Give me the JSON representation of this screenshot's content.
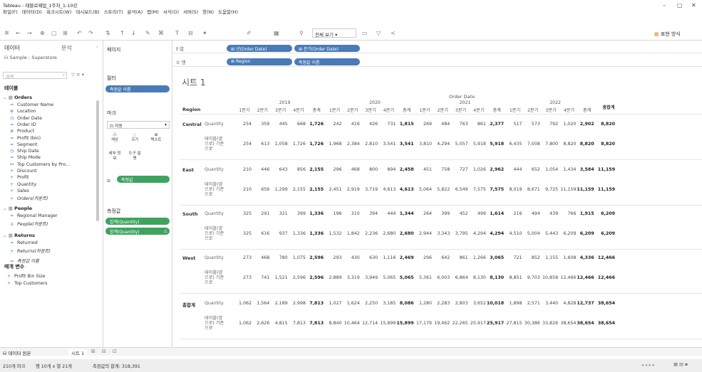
{
  "app": {
    "title": "Tableau - 태블로웨업_1주차_1-10강",
    "menu": [
      "파일(F)",
      "데이터(D)",
      "워크시트(W)",
      "대시보드(B)",
      "스토리(T)",
      "분석(A)",
      "맵(M)",
      "서식(O)",
      "서버(S)",
      "창(N)",
      "도움말(H)"
    ],
    "view_select": "전체 보기",
    "show_me": "표현 방식"
  },
  "left": {
    "tab_data": "데이터",
    "tab_analysis": "분석",
    "source": "Sample - Superstore",
    "search_placeholder": "검색",
    "tables_header": "테이블",
    "orders": "Orders",
    "fields": [
      "Customer Name",
      "Location",
      "Order Date",
      "Order ID",
      "Product",
      "Profit (bin)",
      "Segment",
      "Ship Date",
      "Ship Mode",
      "Top Customers by Pro...",
      "Discount",
      "Profit",
      "Quantity",
      "Sales",
      "Orders(카운트)"
    ],
    "people": "People",
    "people_fields": [
      "Regional Manager",
      "People(카운트)"
    ],
    "returns": "Returns",
    "returns_fields": [
      "Returned",
      "Returns(카운트)"
    ],
    "measure_names": "측정값 이름",
    "params_header": "매개 변수",
    "params": [
      "Profit Bin Size",
      "Top Customers"
    ]
  },
  "cards": {
    "pages": "페이지",
    "filters": "필터",
    "filter_pill": "측정값 이름",
    "marks": "마크",
    "mark_type": "자동",
    "mark_buttons": [
      "색상",
      "크기",
      "텍스트",
      "세부 정보",
      "도구 설명"
    ],
    "marks_pill": "측정값",
    "measures_header": "측정값",
    "measure_pills": [
      "합계(Quantity)",
      "합계(Quantity)"
    ]
  },
  "shelves": {
    "columns_label": "열",
    "columns": [
      "년(Order Date)",
      "분기(Order Date)"
    ],
    "rows_label": "행",
    "rows": [
      "Region",
      "측정값 이름"
    ]
  },
  "viz": {
    "sheet_title": "시트 1",
    "order_date_header": "Order Date",
    "region_header": "Region",
    "years": [
      "2019",
      "2020",
      "2021",
      "2022"
    ],
    "quarters": [
      "1분기",
      "2분기",
      "3분기",
      "4분기",
      "총계"
    ],
    "grand_total": "총합계",
    "measure_labels": [
      "Quantity",
      "테이블(옆으로) 기준으로"
    ],
    "regions": [
      {
        "name": "Central",
        "rows": [
          [
            "254",
            "359",
            "445",
            "668",
            "1,726",
            "242",
            "416",
            "426",
            "731",
            "1,815",
            "269",
            "484",
            "763",
            "861",
            "2,377",
            "517",
            "573",
            "792",
            "1,020",
            "2,902",
            "8,820"
          ],
          [
            "254",
            "613",
            "1,058",
            "1,726",
            "1,726",
            "1,968",
            "2,384",
            "2,810",
            "3,541",
            "3,541",
            "3,810",
            "4,294",
            "5,057",
            "5,918",
            "5,918",
            "6,435",
            "7,008",
            "7,800",
            "8,820",
            "8,820",
            "8,820"
          ]
        ]
      },
      {
        "name": "East",
        "rows": [
          [
            "210",
            "446",
            "643",
            "856",
            "2,155",
            "296",
            "468",
            "800",
            "894",
            "2,458",
            "451",
            "758",
            "727",
            "1,026",
            "2,962",
            "444",
            "652",
            "1,054",
            "1,434",
            "3,584",
            "11,159"
          ],
          [
            "210",
            "656",
            "1,299",
            "2,155",
            "2,155",
            "2,451",
            "2,919",
            "3,719",
            "4,613",
            "4,613",
            "5,064",
            "5,822",
            "6,549",
            "7,575",
            "7,575",
            "8,019",
            "8,671",
            "9,725",
            "11,159",
            "11,159",
            "11,159"
          ]
        ]
      },
      {
        "name": "South",
        "rows": [
          [
            "325",
            "291",
            "321",
            "399",
            "1,336",
            "196",
            "310",
            "394",
            "444",
            "1,344",
            "264",
            "399",
            "452",
            "499",
            "1,614",
            "216",
            "494",
            "439",
            "766",
            "1,915",
            "6,209"
          ],
          [
            "325",
            "616",
            "937",
            "1,336",
            "1,336",
            "1,532",
            "1,842",
            "2,236",
            "2,680",
            "2,680",
            "2,944",
            "3,343",
            "3,795",
            "4,294",
            "4,294",
            "4,510",
            "5,004",
            "5,443",
            "6,209",
            "6,209",
            "6,209"
          ]
        ]
      },
      {
        "name": "West",
        "rows": [
          [
            "273",
            "468",
            "780",
            "1,075",
            "2,596",
            "293",
            "430",
            "630",
            "1,116",
            "2,469",
            "296",
            "642",
            "861",
            "1,266",
            "3,065",
            "721",
            "852",
            "1,155",
            "1,608",
            "4,336",
            "12,466"
          ],
          [
            "273",
            "741",
            "1,521",
            "2,596",
            "2,596",
            "2,889",
            "3,319",
            "3,949",
            "5,065",
            "5,065",
            "5,361",
            "6,003",
            "6,864",
            "8,130",
            "8,130",
            "8,851",
            "9,703",
            "10,858",
            "12,466",
            "12,466",
            "12,466"
          ]
        ]
      },
      {
        "name": "총합계",
        "rows": [
          [
            "1,062",
            "1,564",
            "2,189",
            "2,998",
            "7,813",
            "1,027",
            "1,624",
            "2,250",
            "3,185",
            "8,086",
            "1,280",
            "2,283",
            "2,803",
            "3,652",
            "10,018",
            "1,898",
            "2,571",
            "3,440",
            "4,828",
            "12,737",
            "38,654"
          ],
          [
            "1,062",
            "2,626",
            "4,815",
            "7,813",
            "7,813",
            "8,840",
            "10,464",
            "12,714",
            "15,899",
            "15,899",
            "17,179",
            "19,462",
            "22,265",
            "25,917",
            "25,917",
            "27,815",
            "30,386",
            "33,826",
            "38,654",
            "38,654",
            "38,654"
          ]
        ]
      }
    ]
  },
  "bottom": {
    "datasource_tab": "데이터 원본",
    "sheet_tab": "시트 1",
    "status_marks": "210개 마크",
    "status_rows": "행 10개 x 열 21개",
    "status_sum": "측정값의 합계: 318,391"
  },
  "colors": {
    "blue_pill": "#4a7bb7",
    "green_pill": "#3ea35f"
  }
}
